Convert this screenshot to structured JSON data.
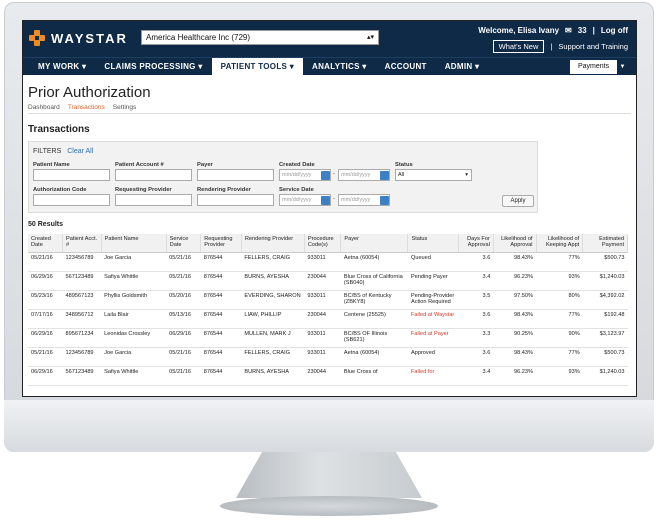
{
  "brand": {
    "name": "WAYSTAR"
  },
  "header": {
    "org_select": "America Healthcare Inc (729)",
    "welcome": "Welcome, Elisa Ivany",
    "mail_count": "33",
    "logout": "Log off",
    "whats_new": "What's New",
    "support": "Support and Training"
  },
  "nav": {
    "items": [
      "MY WORK",
      "CLAIMS PROCESSING",
      "PATIENT TOOLS",
      "ANALYTICS",
      "ACCOUNT",
      "ADMIN"
    ],
    "payments": "Payments"
  },
  "page": {
    "title": "Prior Authorization",
    "tabs": [
      "Dashboard",
      "Transactions",
      "Settings"
    ],
    "section_title": "Transactions"
  },
  "filters": {
    "title": "FILTERS",
    "clear": "Clear All",
    "labels": {
      "patient_name": "Patient Name",
      "patient_account": "Patient Account #",
      "payer": "Payer",
      "created_date": "Created Date",
      "status": "Status",
      "authorization_code": "Authorization Code",
      "requesting_provider": "Requesting Provider",
      "rendering_provider": "Rendering Provider",
      "service_date": "Service Date"
    },
    "date_placeholder": "mm/dd/yyyy",
    "date_sep": "-",
    "status_value": "All",
    "apply": "Apply"
  },
  "results": {
    "count_label": "50 Results"
  },
  "table": {
    "columns": [
      "Created Date",
      "Patient Acct. #",
      "Patient Name",
      "Service Date",
      "Requesting Provider",
      "Rendering Provider",
      "Procedure Code(s)",
      "Payer",
      "Status",
      "Days For Approval",
      "Likelihood of Approval",
      "Likelihood of Keeping Appt",
      "Estimated Payment"
    ],
    "rows": [
      [
        "05/21/16",
        "123456789",
        "Joe Garcia",
        "05/21/16",
        "876544",
        "FELLERS, CRAIG",
        "933011",
        "Aetna (60054)",
        "Queued",
        "3.6",
        "98.43%",
        "77%",
        "$500.73"
      ],
      [
        "06/29/16",
        "567123489",
        "Safiya Whittle",
        "05/21/16",
        "876544",
        "BURNS, AYESHA",
        "230044",
        "Blue Cross of California (SB040)",
        "Pending Payer",
        "3.4",
        "96.23%",
        "93%",
        "$1,240.03"
      ],
      [
        "05/23/16",
        "489567123",
        "Phyllis Goldsmith",
        "05/20/16",
        "876544",
        "EVERDING, SHARON",
        "933011",
        "BC/BS of Kentucky (ZBKY8)",
        "Pending-Provider Action Required",
        "3.5",
        "97.50%",
        "80%",
        "$4,392.02"
      ],
      [
        "07/17/16",
        "348956712",
        "Laila Blair",
        "05/13/16",
        "876544",
        "LIAW, PHILLIP",
        "230044",
        "Centene (25525)",
        "Failed at Waystar",
        "3.6",
        "98.43%",
        "77%",
        "$192.48"
      ],
      [
        "06/29/16",
        "895671234",
        "Leonidas Crossley",
        "06/29/16",
        "876544",
        "MULLEN, MARK J",
        "933011",
        "BC/BS OF Illinois (SB621)",
        "Failed at Payer",
        "3.3",
        "90.25%",
        "90%",
        "$3,123.97"
      ],
      [
        "05/21/16",
        "123456789",
        "Joe Garcia",
        "05/21/16",
        "876544",
        "FELLERS, CRAIG",
        "933011",
        "Aetna (60054)",
        "Approved",
        "3.6",
        "98.43%",
        "77%",
        "$500.73"
      ],
      [
        "06/29/16",
        "567123489",
        "Safiya Whittle",
        "05/21/16",
        "876544",
        "BURNS, AYESHA",
        "230044",
        "Blue Cross of",
        "Failed for",
        "3.4",
        "96.23%",
        "93%",
        "$1,240.03"
      ]
    ],
    "red_status": [
      "Failed at Waystar",
      "Failed at Payer",
      "Failed for"
    ]
  },
  "colors": {
    "navy": "#0e2a47",
    "accent": "#e0642a",
    "error": "#d43a2b"
  }
}
